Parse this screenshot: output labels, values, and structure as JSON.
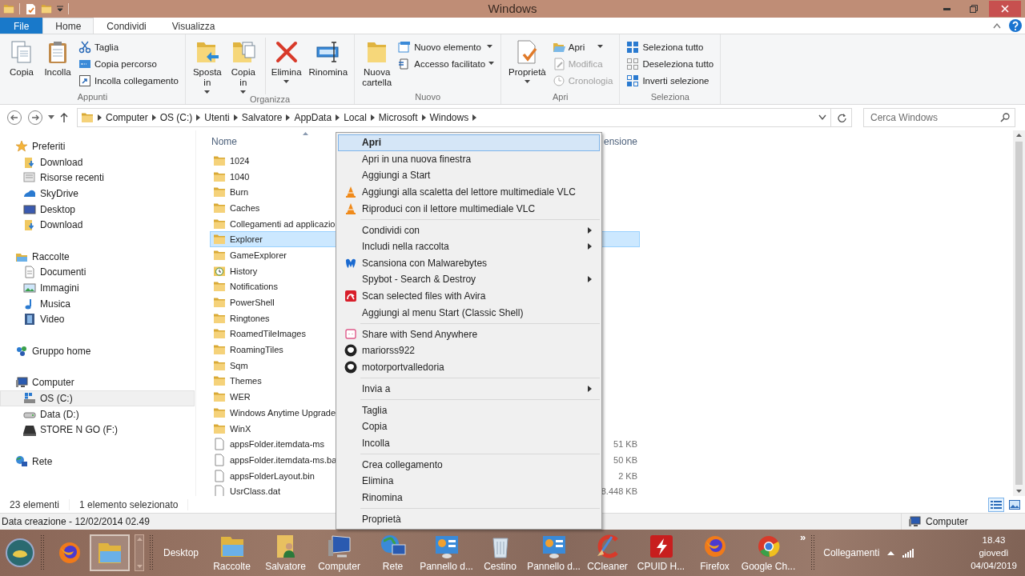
{
  "window": {
    "title": "Windows"
  },
  "ribbon": {
    "tabs": [
      {
        "label": "File",
        "kind": "file",
        "selected": false
      },
      {
        "label": "Home",
        "kind": "tab",
        "selected": true
      },
      {
        "label": "Condividi",
        "kind": "tab",
        "selected": false
      },
      {
        "label": "Visualizza",
        "kind": "tab",
        "selected": false
      }
    ],
    "groups": [
      {
        "label": "Appunti",
        "large": [
          {
            "label": "Copia",
            "dropdown": false,
            "divider_before": false
          },
          {
            "label": "Incolla",
            "dropdown": false,
            "divider_before": false
          }
        ],
        "small": [
          {
            "label": "Taglia",
            "dropdown": false,
            "disabled": false
          },
          {
            "label": "Copia percorso",
            "dropdown": false,
            "disabled": false
          },
          {
            "label": "Incolla collegamento",
            "dropdown": false,
            "disabled": false
          }
        ]
      },
      {
        "label": "Organizza",
        "large": [
          {
            "label": "Sposta in",
            "dropdown": true,
            "divider_before": false
          },
          {
            "label": "Copia in",
            "dropdown": true,
            "divider_before": false
          },
          {
            "label": "Elimina",
            "dropdown": true,
            "divider_before": true
          },
          {
            "label": "Rinomina",
            "dropdown": false,
            "divider_before": false
          }
        ]
      },
      {
        "label": "Nuovo",
        "large": [
          {
            "label": "Nuova cartella",
            "dropdown": false,
            "divider_before": false
          }
        ],
        "small": [
          {
            "label": "Nuovo elemento",
            "dropdown": true,
            "disabled": false
          },
          {
            "label": "Accesso facilitato",
            "dropdown": true,
            "disabled": false
          }
        ]
      },
      {
        "label": "Apri",
        "large": [
          {
            "label": "Proprietà",
            "dropdown": true,
            "divider_before": false
          }
        ],
        "small": [
          {
            "label": "Apri",
            "dropdown": true,
            "disabled": false
          },
          {
            "label": "Modifica",
            "dropdown": false,
            "disabled": true
          },
          {
            "label": "Cronologia",
            "dropdown": false,
            "disabled": true
          }
        ]
      },
      {
        "label": "Seleziona",
        "small": [
          {
            "label": "Seleziona tutto",
            "dropdown": false,
            "disabled": false
          },
          {
            "label": "Deseleziona tutto",
            "dropdown": false,
            "disabled": false
          },
          {
            "label": "Inverti selezione",
            "dropdown": false,
            "disabled": false
          }
        ]
      }
    ]
  },
  "address": {
    "crumbs": [
      "Computer",
      "OS (C:)",
      "Utenti",
      "Salvatore",
      "AppData",
      "Local",
      "Microsoft",
      "Windows"
    ]
  },
  "search": {
    "placeholder": "Cerca Windows"
  },
  "navigation": [
    {
      "label": "Preferiti",
      "selected": false,
      "children": [
        {
          "label": "Download",
          "selected": false
        },
        {
          "label": "Risorse recenti",
          "selected": false
        },
        {
          "label": "SkyDrive",
          "selected": false
        },
        {
          "label": "Desktop",
          "selected": false
        },
        {
          "label": "Download",
          "selected": false
        }
      ]
    },
    {
      "label": "Raccolte",
      "selected": false,
      "children": [
        {
          "label": "Documenti",
          "selected": false
        },
        {
          "label": "Immagini",
          "selected": false
        },
        {
          "label": "Musica",
          "selected": false
        },
        {
          "label": "Video",
          "selected": false
        }
      ]
    },
    {
      "label": "Gruppo home",
      "selected": false
    },
    {
      "label": "Computer",
      "selected": false,
      "children": [
        {
          "label": "OS (C:)",
          "selected": true
        },
        {
          "label": "Data (D:)",
          "selected": false
        },
        {
          "label": "STORE N GO (F:)",
          "selected": false
        }
      ]
    },
    {
      "label": "Rete",
      "selected": false
    }
  ],
  "file_list": {
    "columns": [
      {
        "label": "Nome",
        "sorted": true
      },
      {
        "label": "ensione",
        "sorted": false
      }
    ],
    "rows": [
      {
        "name": "1024",
        "kind": "folder",
        "selected": false
      },
      {
        "name": "1040",
        "kind": "folder",
        "selected": false
      },
      {
        "name": "Burn",
        "kind": "folder",
        "selected": false
      },
      {
        "name": "Caches",
        "kind": "folder",
        "selected": false
      },
      {
        "name": "Collegamenti ad applicazio",
        "kind": "folder",
        "selected": false
      },
      {
        "name": "Explorer",
        "kind": "folder",
        "selected": true
      },
      {
        "name": "GameExplorer",
        "kind": "folder",
        "selected": false
      },
      {
        "name": "History",
        "kind": "special",
        "selected": false
      },
      {
        "name": "Notifications",
        "kind": "folder",
        "selected": false
      },
      {
        "name": "PowerShell",
        "kind": "folder",
        "selected": false
      },
      {
        "name": "Ringtones",
        "kind": "folder",
        "selected": false
      },
      {
        "name": "RoamedTileImages",
        "kind": "folder",
        "selected": false
      },
      {
        "name": "RoamingTiles",
        "kind": "folder",
        "selected": false
      },
      {
        "name": "Sqm",
        "kind": "folder",
        "selected": false
      },
      {
        "name": "Themes",
        "kind": "folder",
        "selected": false
      },
      {
        "name": "WER",
        "kind": "folder",
        "selected": false
      },
      {
        "name": "Windows Anytime Upgrade",
        "kind": "folder",
        "selected": false
      },
      {
        "name": "WinX",
        "kind": "folder",
        "selected": false
      },
      {
        "name": "appsFolder.itemdata-ms",
        "kind": "file",
        "size": "51 KB",
        "selected": false
      },
      {
        "name": "appsFolder.itemdata-ms.ba",
        "kind": "file",
        "size": "50 KB",
        "selected": false
      },
      {
        "name": "appsFolderLayout.bin",
        "kind": "file",
        "size": "2 KB",
        "selected": false
      },
      {
        "name": "UsrClass.dat",
        "kind": "file",
        "size": "8.448 KB",
        "selected": false
      }
    ]
  },
  "status_bar": {
    "count": "23 elementi",
    "selection": "1 elemento selezionato",
    "views": [
      {
        "selected": true
      },
      {
        "selected": false
      }
    ]
  },
  "details_bar": {
    "text": "Data creazione - 12/02/2014 02.49",
    "location": "Computer"
  },
  "context_menu": {
    "groups": [
      [
        {
          "label": "Apri",
          "default": true,
          "selected": true,
          "submenu": false
        },
        {
          "label": "Apri in una nuova finestra",
          "default": false,
          "selected": false,
          "submenu": false
        },
        {
          "label": "Aggiungi a Start",
          "default": false,
          "selected": false,
          "submenu": false
        },
        {
          "label": "Aggiungi alla scaletta del lettore multimediale VLC",
          "default": false,
          "selected": false,
          "submenu": false
        },
        {
          "label": "Riproduci con il lettore multimediale VLC",
          "default": false,
          "selected": false,
          "submenu": false
        }
      ],
      [
        {
          "label": "Condividi con",
          "default": false,
          "selected": false,
          "submenu": true
        },
        {
          "label": "Includi nella raccolta",
          "default": false,
          "selected": false,
          "submenu": true
        },
        {
          "label": "Scansiona con Malwarebytes",
          "default": false,
          "selected": false,
          "submenu": false
        },
        {
          "label": "Spybot - Search & Destroy",
          "default": false,
          "selected": false,
          "submenu": true
        },
        {
          "label": "Scan selected files with Avira",
          "default": false,
          "selected": false,
          "submenu": false
        },
        {
          "label": "Aggiungi al menu Start (Classic Shell)",
          "default": false,
          "selected": false,
          "submenu": false
        }
      ],
      [
        {
          "label": "Share with Send Anywhere",
          "default": false,
          "selected": false,
          "submenu": false
        },
        {
          "label": "mariorss922",
          "default": false,
          "selected": false,
          "submenu": false
        },
        {
          "label": "motorportvalledoria",
          "default": false,
          "selected": false,
          "submenu": false
        }
      ],
      [
        {
          "label": "Invia a",
          "default": false,
          "selected": false,
          "submenu": true
        }
      ],
      [
        {
          "label": "Taglia",
          "default": false,
          "selected": false,
          "submenu": false
        },
        {
          "label": "Copia",
          "default": false,
          "selected": false,
          "submenu": false
        },
        {
          "label": "Incolla",
          "default": false,
          "selected": false,
          "submenu": false
        }
      ],
      [
        {
          "label": "Crea collegamento",
          "default": false,
          "selected": false,
          "submenu": false
        },
        {
          "label": "Elimina",
          "default": false,
          "selected": false,
          "submenu": false
        },
        {
          "label": "Rinomina",
          "default": false,
          "selected": false,
          "submenu": false
        }
      ],
      [
        {
          "label": "Proprietà",
          "default": false,
          "selected": false,
          "submenu": false
        }
      ]
    ]
  },
  "taskbar": {
    "pinned": [
      {
        "active": false
      },
      {
        "active": true
      }
    ],
    "toolbar_label": "Desktop",
    "items": [
      {
        "label": "Raccolte"
      },
      {
        "label": "Salvatore"
      },
      {
        "label": "Computer"
      },
      {
        "label": "Rete"
      },
      {
        "label": "Pannello d..."
      },
      {
        "label": "Cestino"
      },
      {
        "label": "Pannello d..."
      },
      {
        "label": "CCleaner"
      },
      {
        "label": "CPUID H..."
      },
      {
        "label": "Firefox"
      },
      {
        "label": "Google Ch..."
      }
    ],
    "overflow": "»",
    "links": "Collegamenti",
    "clock": {
      "time": "18.43",
      "day": "giovedì",
      "date": "04/04/2019"
    }
  }
}
